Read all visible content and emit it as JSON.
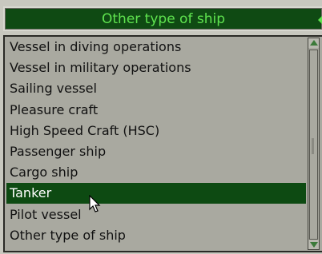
{
  "dropdown": {
    "selected_value": "Other type of ship",
    "arrow_icon": "dropdown-arrow-icon"
  },
  "list": {
    "items": [
      "Vessel in diving operations",
      "Vessel in military operations",
      "Sailing vessel",
      "Pleasure craft",
      "High Speed Craft (HSC)",
      "Passenger ship",
      "Cargo ship",
      "Tanker",
      "Pilot vessel",
      "Other type of ship"
    ],
    "selected_index": 7
  },
  "scrollbar": {
    "up_icon": "scroll-up-arrow-icon",
    "down_icon": "scroll-down-arrow-icon"
  },
  "cursor": {
    "icon": "mouse-pointer-icon"
  },
  "colors": {
    "selected_bg": "#0d4a12",
    "dropdown_text": "#5fe34f",
    "list_bg": "#a9a9a0"
  }
}
